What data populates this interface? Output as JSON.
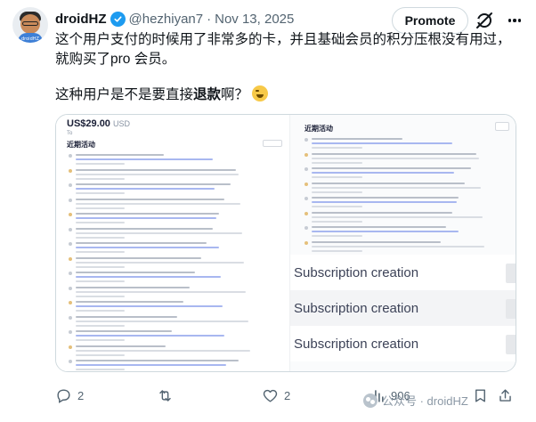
{
  "author": {
    "name": "droidHZ",
    "handle": "@hezhiyan7",
    "separator": "·",
    "date": "Nov 13, 2025",
    "avatar_label": "droidHZ",
    "verified_icon": "verified-badge-icon",
    "verified_color": "#1d9bf0"
  },
  "header_actions": {
    "promote_label": "Promote",
    "grok_icon": "grok-icon",
    "more_icon": "more-icon"
  },
  "tweet": {
    "paragraph1": "这个用户支付的时候用了非常多的卡，并且基础会员的积分压根没有用过，就购买了pro 会员。",
    "paragraph2_before": "这种用户是不是要直接",
    "paragraph2_bold": "退款",
    "paragraph2_after": "啊？",
    "emoji": "rolling-on-floor-laughing-emoji"
  },
  "media": {
    "price_amount": "US$29.00",
    "price_currency": "USD",
    "left_sub": "To",
    "left_section_title": "近期活动",
    "right_section_title": "近期活动",
    "subscription_rows": [
      "Subscription creation",
      "Subscription creation",
      "Subscription creation"
    ]
  },
  "actions": {
    "reply_count": "2",
    "retweet_count": "",
    "like_count": "2",
    "views_count": "906",
    "reply_icon": "reply-icon",
    "retweet_icon": "retweet-icon",
    "like_icon": "heart-icon",
    "views_icon": "views-icon",
    "bookmark_icon": "bookmark-icon",
    "share_icon": "share-icon"
  },
  "watermark": {
    "text": "公众号 · droidHZ"
  },
  "colors": {
    "text_primary": "#0f1419",
    "text_secondary": "#536471",
    "border": "#cfd9de"
  }
}
